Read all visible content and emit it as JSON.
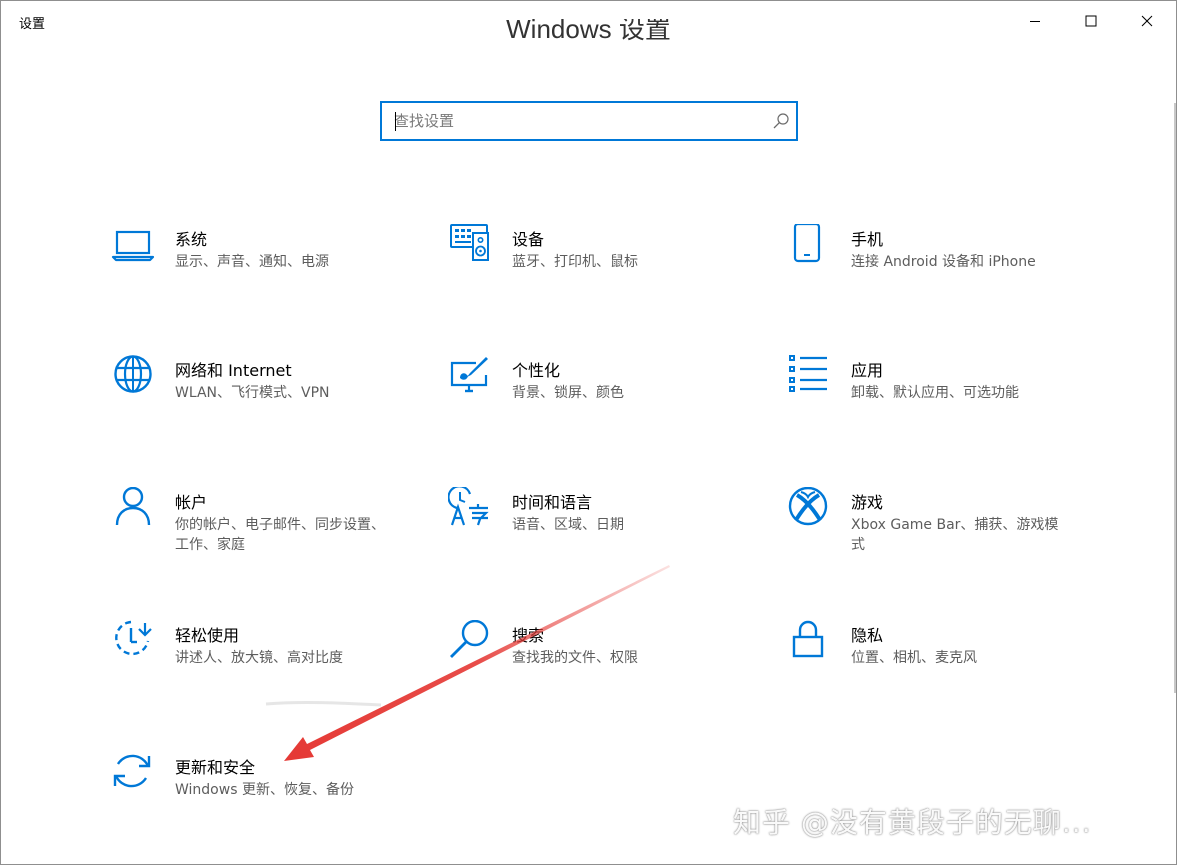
{
  "window": {
    "title": "设置"
  },
  "heading": "Windows 设置",
  "search": {
    "placeholder": "查找设置"
  },
  "tiles": [
    {
      "title": "系统",
      "desc": "显示、声音、通知、电源",
      "icon": "laptop-icon"
    },
    {
      "title": "设备",
      "desc": "蓝牙、打印机、鼠标",
      "icon": "devices-icon"
    },
    {
      "title": "手机",
      "desc": "连接 Android 设备和 iPhone",
      "icon": "phone-icon"
    },
    {
      "title": "网络和 Internet",
      "desc": "WLAN、飞行模式、VPN",
      "icon": "globe-icon"
    },
    {
      "title": "个性化",
      "desc": "背景、锁屏、颜色",
      "icon": "personalization-icon"
    },
    {
      "title": "应用",
      "desc": "卸载、默认应用、可选功能",
      "icon": "apps-list-icon"
    },
    {
      "title": "帐户",
      "desc": "你的帐户、电子邮件、同步设置、工作、家庭",
      "icon": "person-icon"
    },
    {
      "title": "时间和语言",
      "desc": "语音、区域、日期",
      "icon": "time-language-icon"
    },
    {
      "title": "游戏",
      "desc": "Xbox Game Bar、捕获、游戏模式",
      "icon": "xbox-icon"
    },
    {
      "title": "轻松使用",
      "desc": "讲述人、放大镜、高对比度",
      "icon": "ease-of-access-icon"
    },
    {
      "title": "搜索",
      "desc": "查找我的文件、权限",
      "icon": "search-icon"
    },
    {
      "title": "隐私",
      "desc": "位置、相机、麦克风",
      "icon": "lock-icon"
    },
    {
      "title": "更新和安全",
      "desc": "Windows 更新、恢复、备份",
      "icon": "sync-icon"
    }
  ],
  "watermark": "知乎 @没有黄段子的无聊...",
  "colors": {
    "accent": "#0078d7",
    "arrow": "#e53935"
  }
}
